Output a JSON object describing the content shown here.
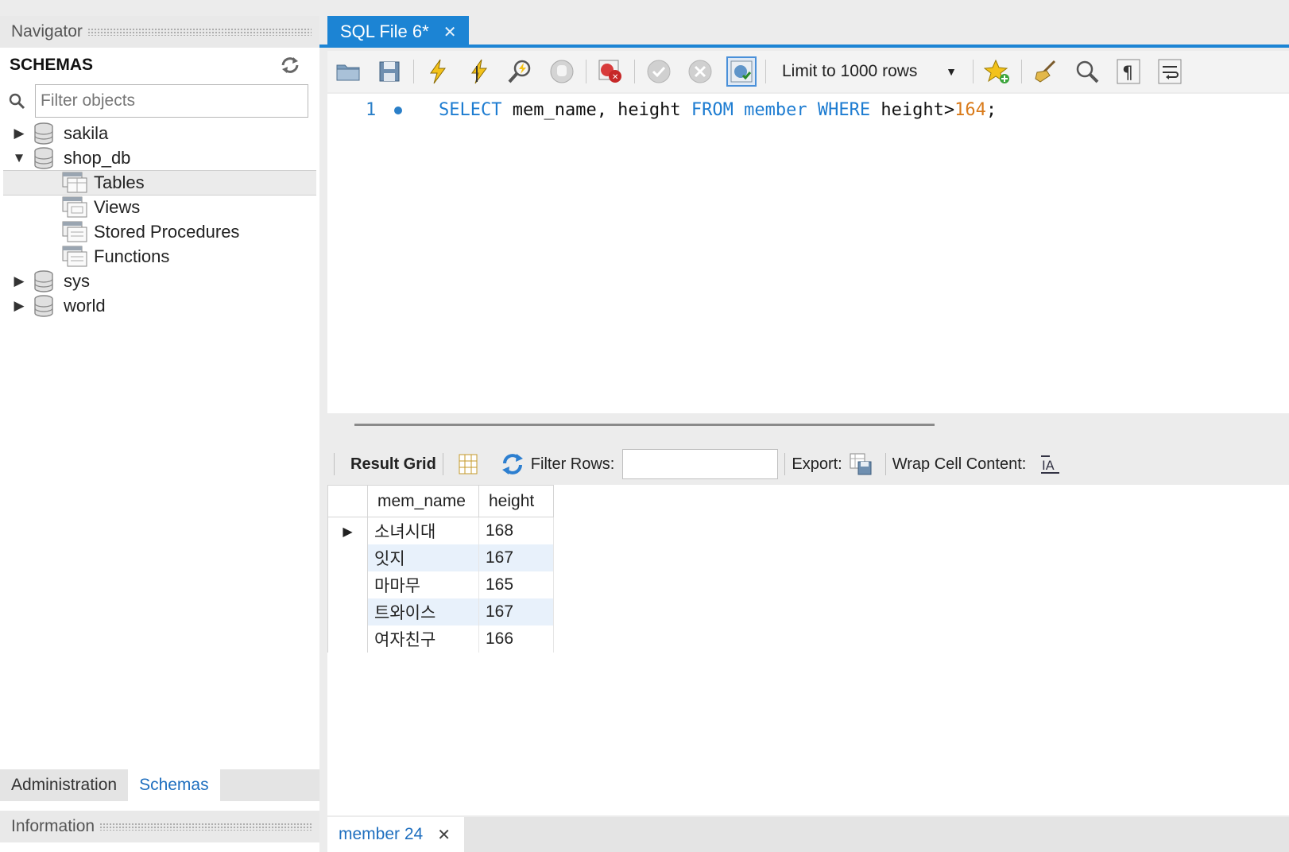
{
  "navigator": {
    "title": "Navigator",
    "schemas_label": "SCHEMAS",
    "filter_placeholder": "Filter objects",
    "schemas": [
      {
        "name": "sakila",
        "expanded": false
      },
      {
        "name": "shop_db",
        "expanded": true,
        "children": [
          "Tables",
          "Views",
          "Stored Procedures",
          "Functions"
        ],
        "selected_child": "Tables"
      },
      {
        "name": "sys",
        "expanded": false
      },
      {
        "name": "world",
        "expanded": false
      }
    ],
    "bottom_tabs": [
      "Administration",
      "Schemas"
    ],
    "active_bottom_tab": "Schemas",
    "info_title": "Information"
  },
  "editor": {
    "tab_label": "SQL File 6*",
    "limit_label": "Limit to 1000 rows",
    "line_number": "1",
    "sql": {
      "kw_select": "SELECT",
      "cols": " mem_name, height ",
      "kw_from": "FROM",
      "sp1": " ",
      "table": "member",
      "sp2": " ",
      "kw_where": "WHERE",
      "cond": " height>",
      "value": "164",
      "end": ";"
    }
  },
  "result": {
    "result_grid_label": "Result Grid",
    "filter_rows_label": "Filter Rows:",
    "export_label": "Export:",
    "wrap_label": "Wrap Cell Content:",
    "columns": [
      "mem_name",
      "height"
    ],
    "rows": [
      {
        "mem_name": "소녀시대",
        "height": "168"
      },
      {
        "mem_name": "잇지",
        "height": "167"
      },
      {
        "mem_name": "마마무",
        "height": "165"
      },
      {
        "mem_name": "트와이스",
        "height": "167"
      },
      {
        "mem_name": "여자친구",
        "height": "166"
      }
    ],
    "bottom_tab": "member 24"
  },
  "colors": {
    "accent": "#1c84d4",
    "keyword": "#1d7cd1",
    "number": "#d97a1a",
    "alt_row": "#e8f1fb"
  }
}
